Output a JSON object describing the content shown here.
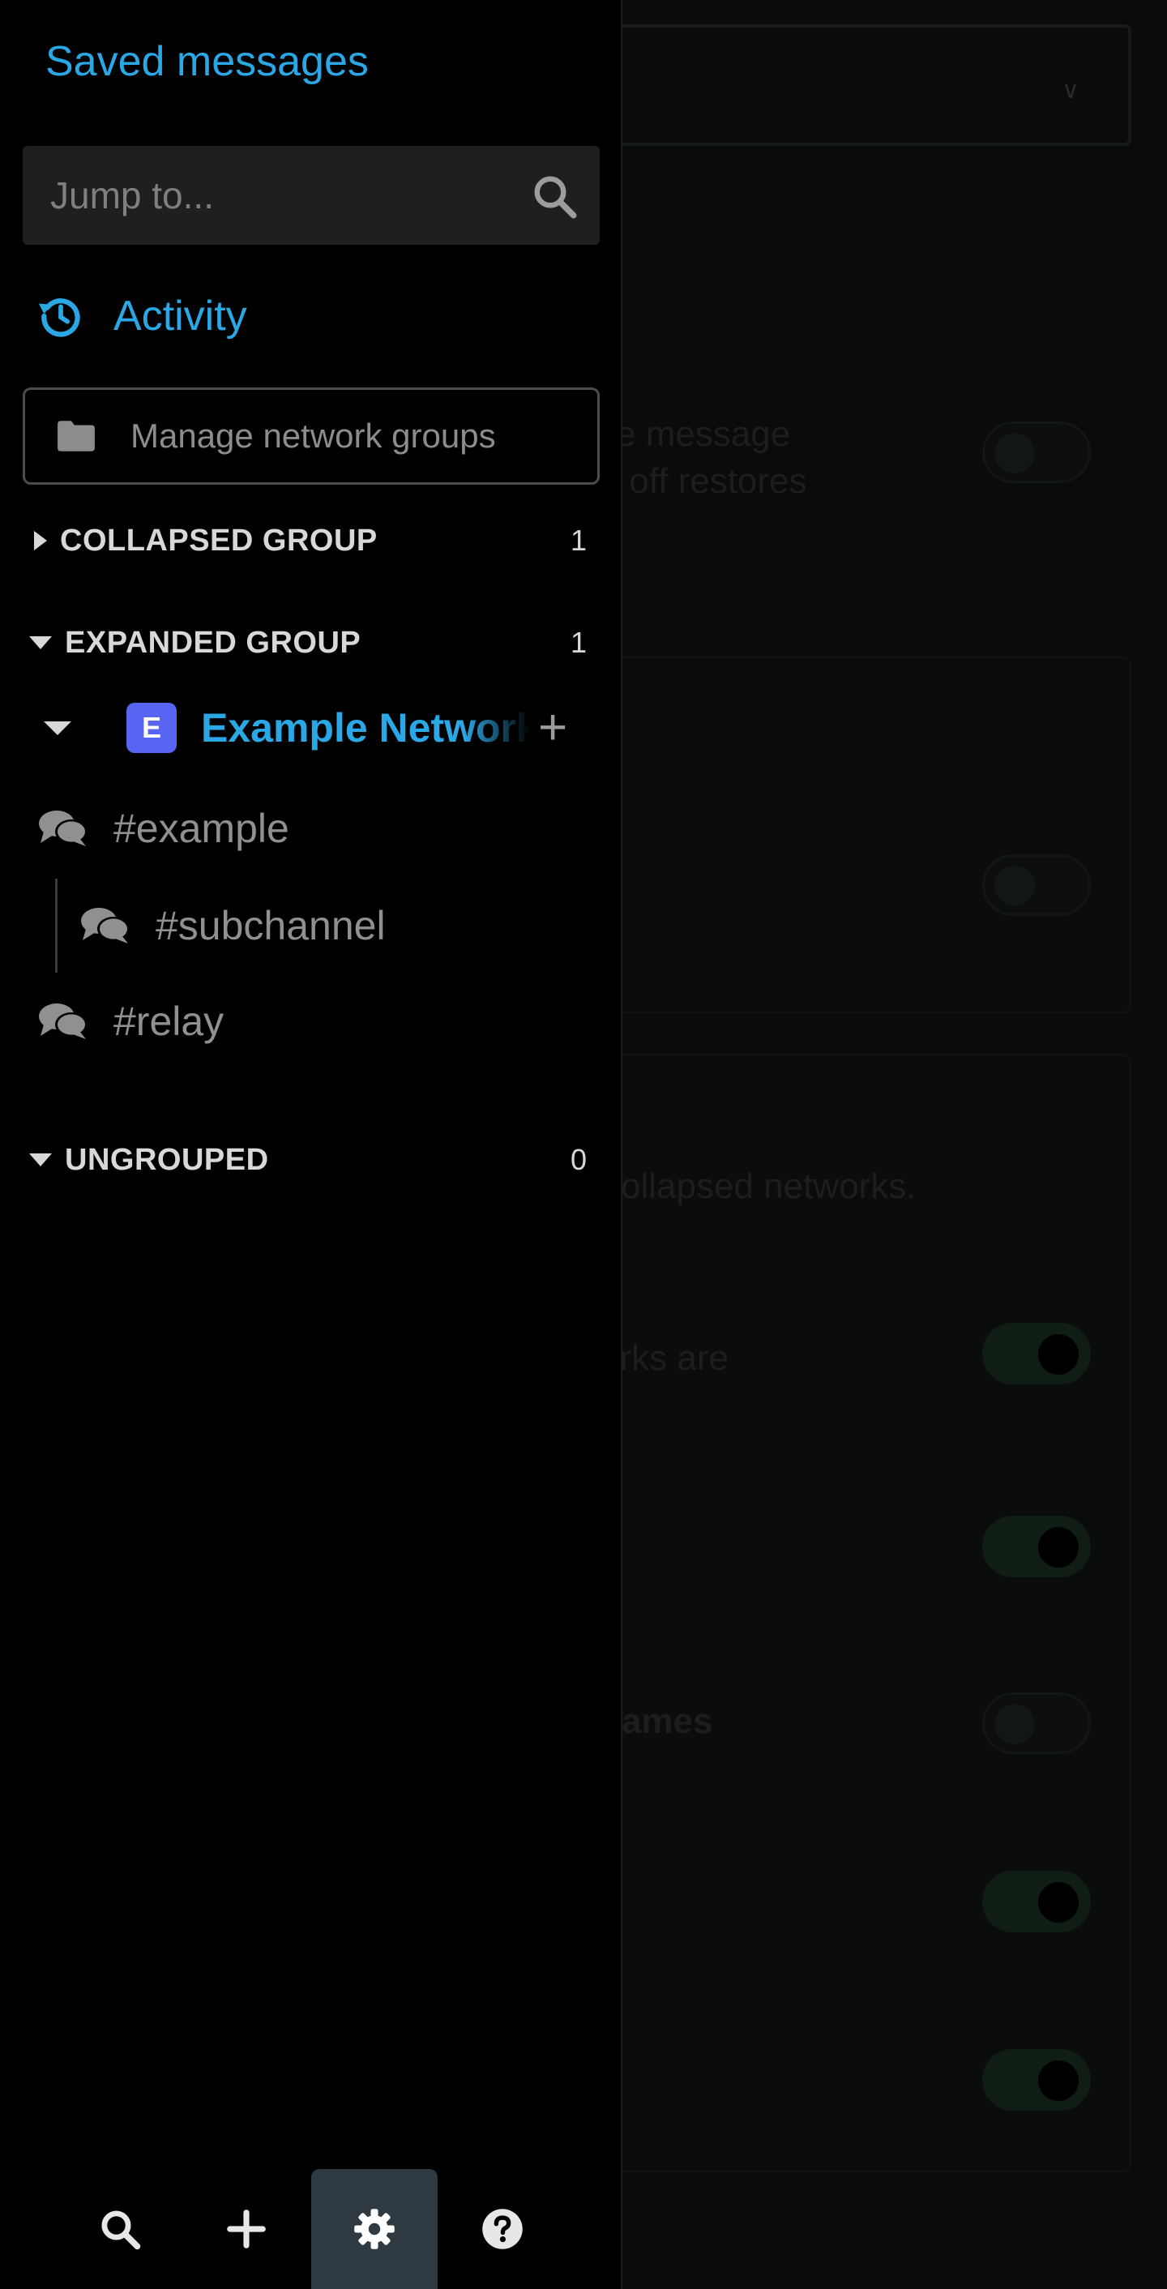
{
  "background": {
    "texts": [
      {
        "id": "bg-text-1",
        "text": "e message"
      },
      {
        "id": "bg-text-2",
        "text": "s off restores"
      },
      {
        "id": "bg-text-3",
        "text": "ollapsed networks."
      },
      {
        "id": "bg-text-4",
        "text": "orks are"
      },
      {
        "id": "bg-text-5",
        "text": "names"
      }
    ],
    "toggles": [
      {
        "state": "off"
      },
      {
        "state": "off"
      },
      {
        "state": "on"
      },
      {
        "state": "on"
      },
      {
        "state": "off"
      },
      {
        "state": "on"
      },
      {
        "state": "on"
      }
    ]
  },
  "drawer": {
    "saved_messages": "Saved messages",
    "jump_placeholder": "Jump to...",
    "activity_label": "Activity",
    "manage_groups_label": "Manage network groups",
    "groups": [
      {
        "label": "COLLAPSED GROUP",
        "count": "1",
        "expanded": false
      },
      {
        "label": "EXPANDED GROUP",
        "count": "1",
        "expanded": true
      },
      {
        "label": "UNGROUPED",
        "count": "0",
        "expanded": true
      }
    ],
    "network": {
      "initial": "E",
      "name": "Example Network",
      "add_label": "+"
    },
    "channels": [
      {
        "name": "#example"
      },
      {
        "name": "#subchannel"
      },
      {
        "name": "#relay"
      }
    ],
    "bottom_bar": {
      "buttons": [
        {
          "icon": "search-icon",
          "active": false
        },
        {
          "icon": "plus-icon",
          "active": false
        },
        {
          "icon": "gear-icon",
          "active": true
        },
        {
          "icon": "help-icon",
          "active": false
        }
      ]
    }
  },
  "colors": {
    "accent": "#2aa8e6",
    "network_badge": "#5865f2",
    "active_tab": "#2e3941"
  }
}
